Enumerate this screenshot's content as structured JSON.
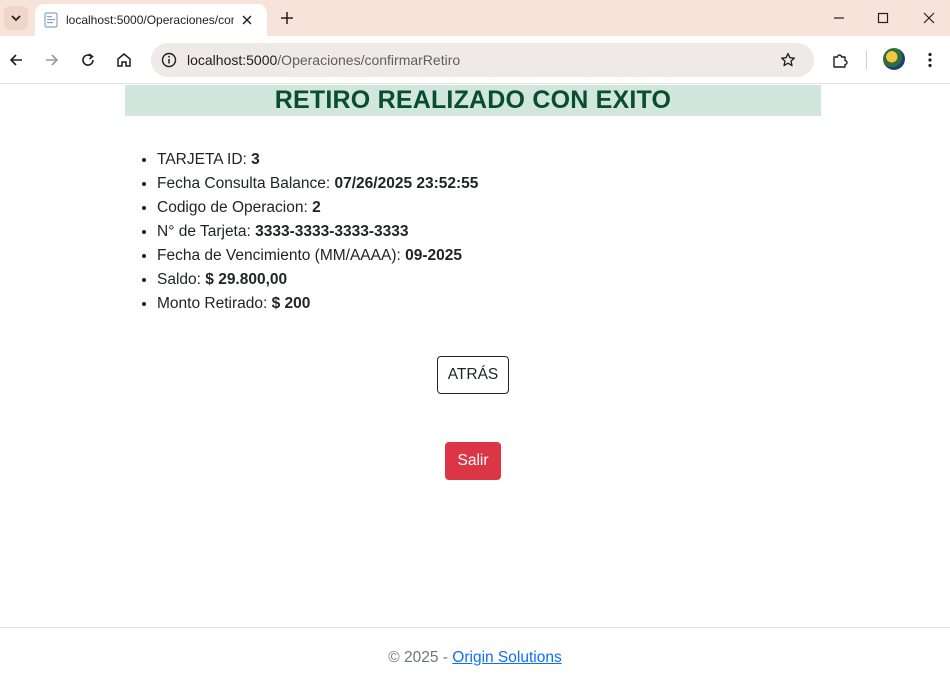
{
  "browser": {
    "tab_title": "localhost:5000/Operaciones/confirmarRetiro",
    "url_host": "localhost:5000",
    "url_path": "/Operaciones/confirmarRetiro"
  },
  "page": {
    "heading": "RETIRO REALIZADO CON EXITO",
    "details": [
      {
        "label": "TARJETA ID: ",
        "value": "3"
      },
      {
        "label": "Fecha Consulta Balance: ",
        "value": "07/26/2025 23:52:55"
      },
      {
        "label": "Codigo de Operacion: ",
        "value": "2"
      },
      {
        "label": "N° de Tarjeta: ",
        "value": "3333-3333-3333-3333"
      },
      {
        "label": "Fecha de Vencimiento (MM/AAAA): ",
        "value": "09-2025"
      },
      {
        "label": "Saldo: ",
        "value": "$ 29.800,00"
      },
      {
        "label": "Monto Retirado: ",
        "value": "$ 200"
      }
    ],
    "back_button": "ATRÁS",
    "exit_button": "Salir"
  },
  "footer": {
    "copyright": "© 2025 - ",
    "link": "Origin Solutions"
  },
  "colors": {
    "banner_bg": "#d1e7dd",
    "banner_text": "#0a4d2e",
    "danger": "#dc3545",
    "link": "#0d6efd",
    "tabstrip": "#f8e3da"
  },
  "icons": [
    "tab-search-icon",
    "favicon-icon",
    "close-icon",
    "plus-icon",
    "minimize-icon",
    "maximize-icon",
    "window-close-icon",
    "back-arrow-icon",
    "forward-arrow-icon",
    "reload-icon",
    "home-icon",
    "site-info-icon",
    "star-icon",
    "extensions-icon",
    "avatar",
    "more-vert-icon"
  ]
}
